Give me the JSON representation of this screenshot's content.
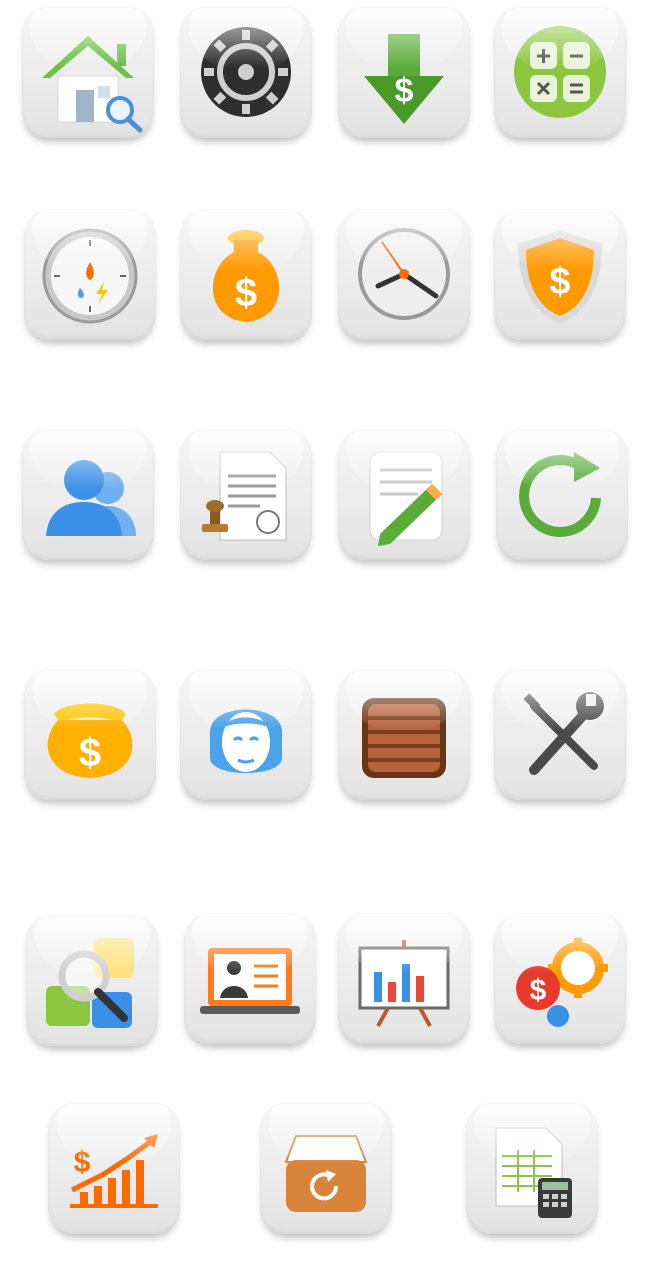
{
  "icon_grid": {
    "rows": [
      [
        "home-search-icon",
        "settings-gear-icon",
        "download-dollar-icon",
        "calculator-icon"
      ],
      [
        "gauge-icon",
        "money-bag-icon",
        "clock-icon",
        "dollar-shield-icon"
      ],
      [
        "users-icon",
        "stamped-document-icon",
        "edit-note-icon",
        "refresh-icon"
      ],
      [
        "gold-coin-bag-icon",
        "support-agent-icon",
        "wooden-crate-icon",
        "tools-icon"
      ],
      [
        "magnifier-tiles-icon",
        "laptop-profile-icon",
        "presentation-chart-icon",
        "finance-gears-icon"
      ],
      [
        "growth-chart-icon",
        "archive-refresh-icon",
        "spreadsheet-calculator-icon"
      ]
    ]
  },
  "colors": {
    "green": "#6cc04a",
    "orange": "#ff9a00",
    "blue": "#3a8fe6",
    "gear_dark": "#3a3a3a",
    "crate_brown": "#8a4a24"
  }
}
